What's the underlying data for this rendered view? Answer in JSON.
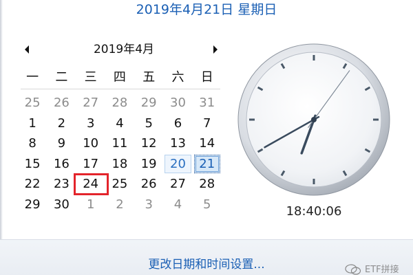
{
  "header": {
    "full_date": "2019年4月21日 星期日"
  },
  "calendar": {
    "month_title": "2019年4月",
    "prev_icon": "triangle-left",
    "next_icon": "triangle-right",
    "weekdays": [
      "一",
      "二",
      "三",
      "四",
      "五",
      "六",
      "日"
    ],
    "weeks": [
      [
        {
          "d": "25",
          "other": true
        },
        {
          "d": "26",
          "other": true
        },
        {
          "d": "27",
          "other": true
        },
        {
          "d": "28",
          "other": true
        },
        {
          "d": "29",
          "other": true
        },
        {
          "d": "30",
          "other": true
        },
        {
          "d": "31",
          "other": true
        }
      ],
      [
        {
          "d": "1"
        },
        {
          "d": "2"
        },
        {
          "d": "3"
        },
        {
          "d": "4"
        },
        {
          "d": "5"
        },
        {
          "d": "6"
        },
        {
          "d": "7"
        }
      ],
      [
        {
          "d": "8"
        },
        {
          "d": "9"
        },
        {
          "d": "10"
        },
        {
          "d": "11"
        },
        {
          "d": "12"
        },
        {
          "d": "13"
        },
        {
          "d": "14"
        }
      ],
      [
        {
          "d": "15"
        },
        {
          "d": "16"
        },
        {
          "d": "17"
        },
        {
          "d": "18"
        },
        {
          "d": "19"
        },
        {
          "d": "20",
          "selected": true
        },
        {
          "d": "21",
          "today": true
        }
      ],
      [
        {
          "d": "22"
        },
        {
          "d": "23"
        },
        {
          "d": "24",
          "marked": true
        },
        {
          "d": "25"
        },
        {
          "d": "26"
        },
        {
          "d": "27"
        },
        {
          "d": "28"
        }
      ],
      [
        {
          "d": "29"
        },
        {
          "d": "30"
        },
        {
          "d": "1",
          "other": true
        },
        {
          "d": "2",
          "other": true
        },
        {
          "d": "3",
          "other": true
        },
        {
          "d": "4",
          "other": true
        },
        {
          "d": "5",
          "other": true
        }
      ]
    ],
    "colors": {
      "accent": "#1a5fb4",
      "marker": "#e3242b",
      "today_fill": "#d7e8f8"
    }
  },
  "clock": {
    "time": "18:40:06",
    "hour": 18,
    "minute": 40,
    "second": 6
  },
  "footer": {
    "change_link": "更改日期和时间设置...",
    "watermark_icon": "wechat-icon",
    "watermark_text": "ETF拼接"
  }
}
